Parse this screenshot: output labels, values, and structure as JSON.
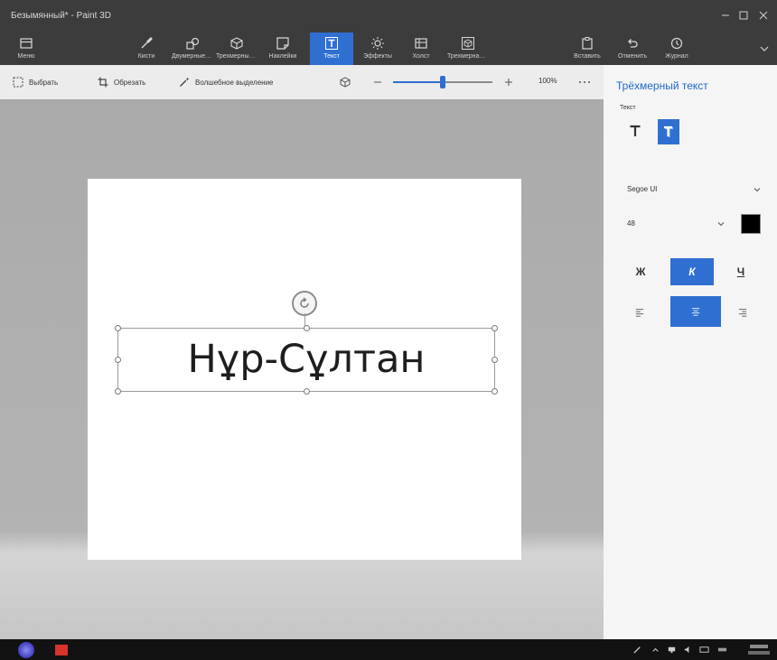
{
  "window": {
    "title": "Безымянный* - Paint 3D",
    "menu_label": "Меню"
  },
  "ribbon": {
    "tools": [
      {
        "label": "Кисти",
        "icon": "brush-icon"
      },
      {
        "label": "Двумерные фигуры",
        "icon": "2d-shapes-icon"
      },
      {
        "label": "Трехмерные фигуры",
        "icon": "3d-shapes-icon"
      },
      {
        "label": "Наклейки",
        "icon": "stickers-icon"
      },
      {
        "label": "Текст",
        "icon": "text-icon",
        "selected": true
      },
      {
        "label": "Эффекты",
        "icon": "effects-icon"
      },
      {
        "label": "Холст",
        "icon": "canvas-icon"
      },
      {
        "label": "Трехмерная библиотека",
        "icon": "3d-library-icon"
      }
    ],
    "actions": [
      {
        "label": "Вставить",
        "icon": "paste-icon"
      },
      {
        "label": "Отменить",
        "icon": "undo-icon"
      },
      {
        "label": "Журнал",
        "icon": "history-icon"
      }
    ]
  },
  "toolbar": {
    "select_label": "Выбрать",
    "crop_label": "Обрезать",
    "magic_select_label": "Волшебное выделение",
    "zoom_value": "100%",
    "zoom_level": 0.5
  },
  "canvas": {
    "text": "Нұр-Сұлтан"
  },
  "panel": {
    "title": "Трёхмерный текст",
    "text_type_label": "Текст",
    "font_value": "Segoe UI",
    "size_value": "48",
    "text_color": "#000000",
    "bold_label": "Ж",
    "italic_label": "К",
    "underline_label": "Ч",
    "italic_active": true,
    "alignment": "center"
  },
  "colors": {
    "accent": "#2f6fd1",
    "title_bar": "#3c3c3c",
    "panel_title": "#1f68c9"
  }
}
